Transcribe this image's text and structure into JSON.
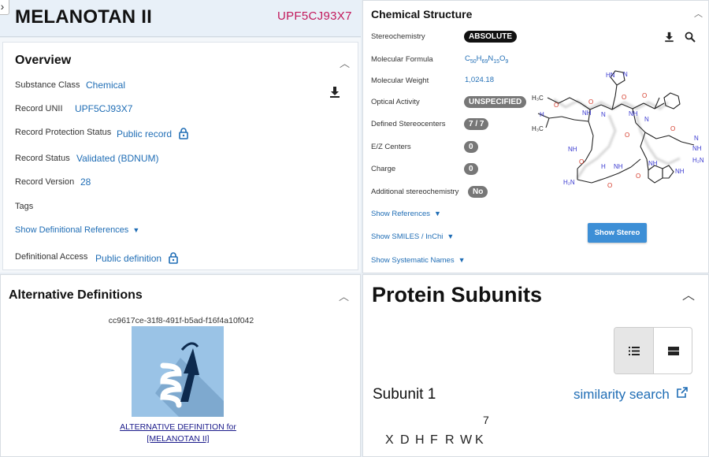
{
  "header": {
    "title": "MELANOTAN II",
    "unii": "UPF5CJ93X7"
  },
  "overview": {
    "title": "Overview",
    "substance_class_label": "Substance Class",
    "substance_class_value": "Chemical",
    "record_unii_label": "Record UNII",
    "record_unii_value": "UPF5CJ93X7",
    "protection_label": "Record Protection Status",
    "protection_value": "Public record",
    "status_label": "Record Status",
    "status_value": "Validated (BDNUM)",
    "version_label": "Record Version",
    "version_value": "28",
    "tags_label": "Tags",
    "show_def_refs": "Show Definitional References",
    "def_access_label": "Definitional Access",
    "def_access_value": "Public definition"
  },
  "chemical_structure": {
    "title": "Chemical Structure",
    "stereochemistry_label": "Stereochemistry",
    "stereochemistry_value": "ABSOLUTE",
    "formula_label": "Molecular Formula",
    "formula_parts": {
      "c": "C",
      "c_n": "50",
      "h": "H",
      "h_n": "69",
      "n": "N",
      "n_n": "15",
      "o": "O",
      "o_n": "9"
    },
    "weight_label": "Molecular Weight",
    "weight_value": "1,024.18",
    "optical_label": "Optical Activity",
    "optical_value": "UNSPECIFIED",
    "defined_label": "Defined Stereocenters",
    "defined_value": "7 / 7",
    "ez_label": "E/Z Centers",
    "ez_value": "0",
    "charge_label": "Charge",
    "charge_value": "0",
    "additional_label": "Additional stereochemistry",
    "additional_value": "No",
    "show_references": "Show References",
    "show_smiles": "Show SMILES / InChi",
    "show_systematic": "Show Systematic Names",
    "show_stereo_button": "Show Stereo",
    "atom_labels": {
      "hn": "HN",
      "n": "N",
      "h3c": "H₃C",
      "nh": "NH",
      "h": "H",
      "o": "O",
      "h2n": "H₂N"
    }
  },
  "alternative_definitions": {
    "title": "Alternative Definitions",
    "id": "cc9617ce-31f8-491f-b5ad-f16f4a10f042",
    "link_line1": "ALTERNATIVE DEFINITION for",
    "link_line2": "[MELANOTAN II]"
  },
  "protein_subunits": {
    "title": "Protein Subunits",
    "subunit_title": "Subunit 1",
    "similarity_search": "similarity search",
    "position_marker": "7",
    "sequence": [
      "X",
      "D",
      "H",
      "F",
      "R",
      "W",
      "K"
    ]
  },
  "colors": {
    "link": "#1f6db5",
    "unii": "#c2185b",
    "button": "#3d8fd6",
    "pill": "#777777",
    "pill_dark": "#111111",
    "thumbnail_bg": "#9ac3e6",
    "thumbnail_arrow": "#0d2a4e"
  }
}
